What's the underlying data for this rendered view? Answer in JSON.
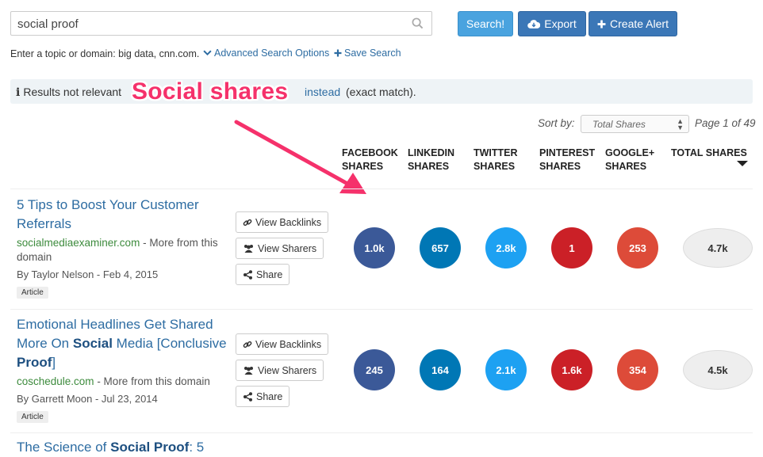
{
  "search": {
    "value": "social proof",
    "search_label": "Search!",
    "export_label": "Export",
    "alert_label": "Create Alert",
    "hint": "Enter a topic or domain: big data, cnn.com.",
    "advanced_label": "Advanced Search Options",
    "save_label": "Save Search"
  },
  "notice": {
    "text": "Results not relevant",
    "link": "instead",
    "tail": "(exact match)."
  },
  "annotation": "Social shares",
  "sort": {
    "label": "Sort by:",
    "selected": "Total Shares",
    "page_info": "Page 1 of 49"
  },
  "columns": {
    "facebook": "FACEBOOK\nSHARES",
    "linkedin": "LINKEDIN\nSHARES",
    "twitter": "TWITTER\nSHARES",
    "pinterest": "PINTEREST\nSHARES",
    "googleplus": "GOOGLE+\nSHARES",
    "total": "TOTAL SHARES"
  },
  "actions": {
    "backlinks": "View Backlinks",
    "sharers": "View Sharers",
    "share": "Share"
  },
  "rows": [
    {
      "title_html": "5 Tips to Boost Your Customer Referrals",
      "domain": "socialmediaexaminer.com",
      "more": " - More from this domain",
      "byline": "By Taylor Nelson - Feb 4, 2015",
      "tag": "Article",
      "facebook": "1.0k",
      "linkedin": "657",
      "twitter": "2.8k",
      "pinterest": "1",
      "googleplus": "253",
      "total": "4.7k"
    },
    {
      "title_pre": "Emotional Headlines Get Shared More On ",
      "title_b1": "Social",
      "title_mid": " Media [Conclusive ",
      "title_b2": "Proof",
      "title_post": "]",
      "domain": "coschedule.com",
      "more": " - More from this domain",
      "byline": "By Garrett Moon - Jul 23, 2014",
      "tag": "Article",
      "facebook": "245",
      "linkedin": "164",
      "twitter": "2.1k",
      "pinterest": "1.6k",
      "googleplus": "354",
      "total": "4.5k"
    },
    {
      "title_pre": "The Science of ",
      "title_b1": "Social Proof",
      "title_post": ": 5"
    }
  ],
  "colors": {
    "facebook": "#3b5998",
    "linkedin": "#0077b5",
    "twitter": "#1da1f2",
    "pinterest": "#cb2027",
    "googleplus": "#dd4b39",
    "annotation": "#f5316b"
  }
}
